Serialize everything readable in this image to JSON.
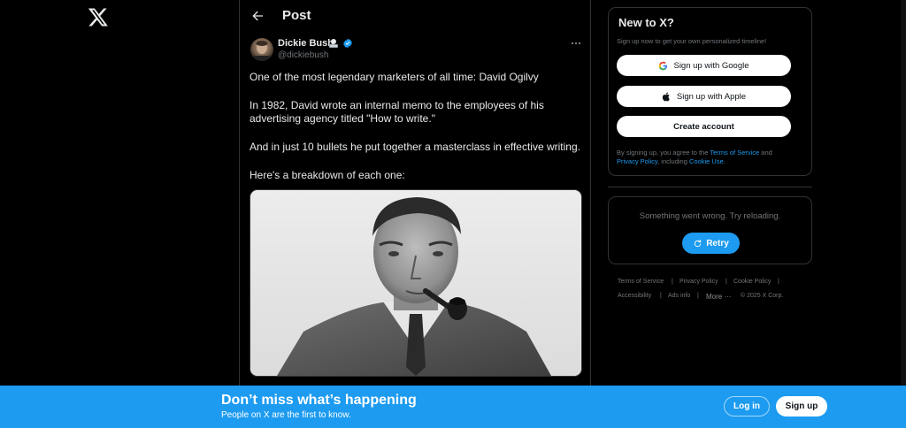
{
  "header": {
    "title": "Post"
  },
  "post": {
    "author_name": "Dickie Bush",
    "author_handle": "@dickiebush",
    "lines": [
      "One of the most legendary marketers of all time: David Ogilvy",
      "In 1982, David wrote an internal memo to the employees of his",
      "advertising agency titled \"How to write.\"",
      "And in just 10 bullets he put together a masterclass in effective writing.",
      "Here's a breakdown of each one:"
    ]
  },
  "signup": {
    "title": "New to X?",
    "subtitle": "Sign up now to get your own personalized timeline!",
    "google_label": "Sign up with Google",
    "apple_label": "Sign up with Apple",
    "create_label": "Create account",
    "legal_prefix": "By signing up, you agree to the ",
    "terms_link": "Terms of Service",
    "legal_and": " and",
    "privacy_link": "Privacy Policy",
    "legal_including": ", including ",
    "cookie_link": "Cookie Use."
  },
  "error": {
    "text": "Something went wrong. Try reloading.",
    "retry_label": "Retry"
  },
  "footer": {
    "terms": "Terms of Service",
    "privacy": "Privacy Policy",
    "cookie": "Cookie Policy",
    "accessibility": "Accessibility",
    "ads": "Ads info",
    "more": "More ···",
    "copyright": "© 2025 X Corp."
  },
  "banner": {
    "title": "Don’t miss what’s happening",
    "subtitle": "People on X are the first to know.",
    "login_label": "Log in",
    "signup_label": "Sign up"
  },
  "colors": {
    "accent": "#1d9bf0",
    "background": "#000000",
    "muted": "#71767b"
  },
  "icons": [
    "x-logo-icon",
    "back-arrow-icon",
    "verified-badge-icon",
    "more-icon",
    "google-icon",
    "apple-icon",
    "refresh-icon"
  ]
}
